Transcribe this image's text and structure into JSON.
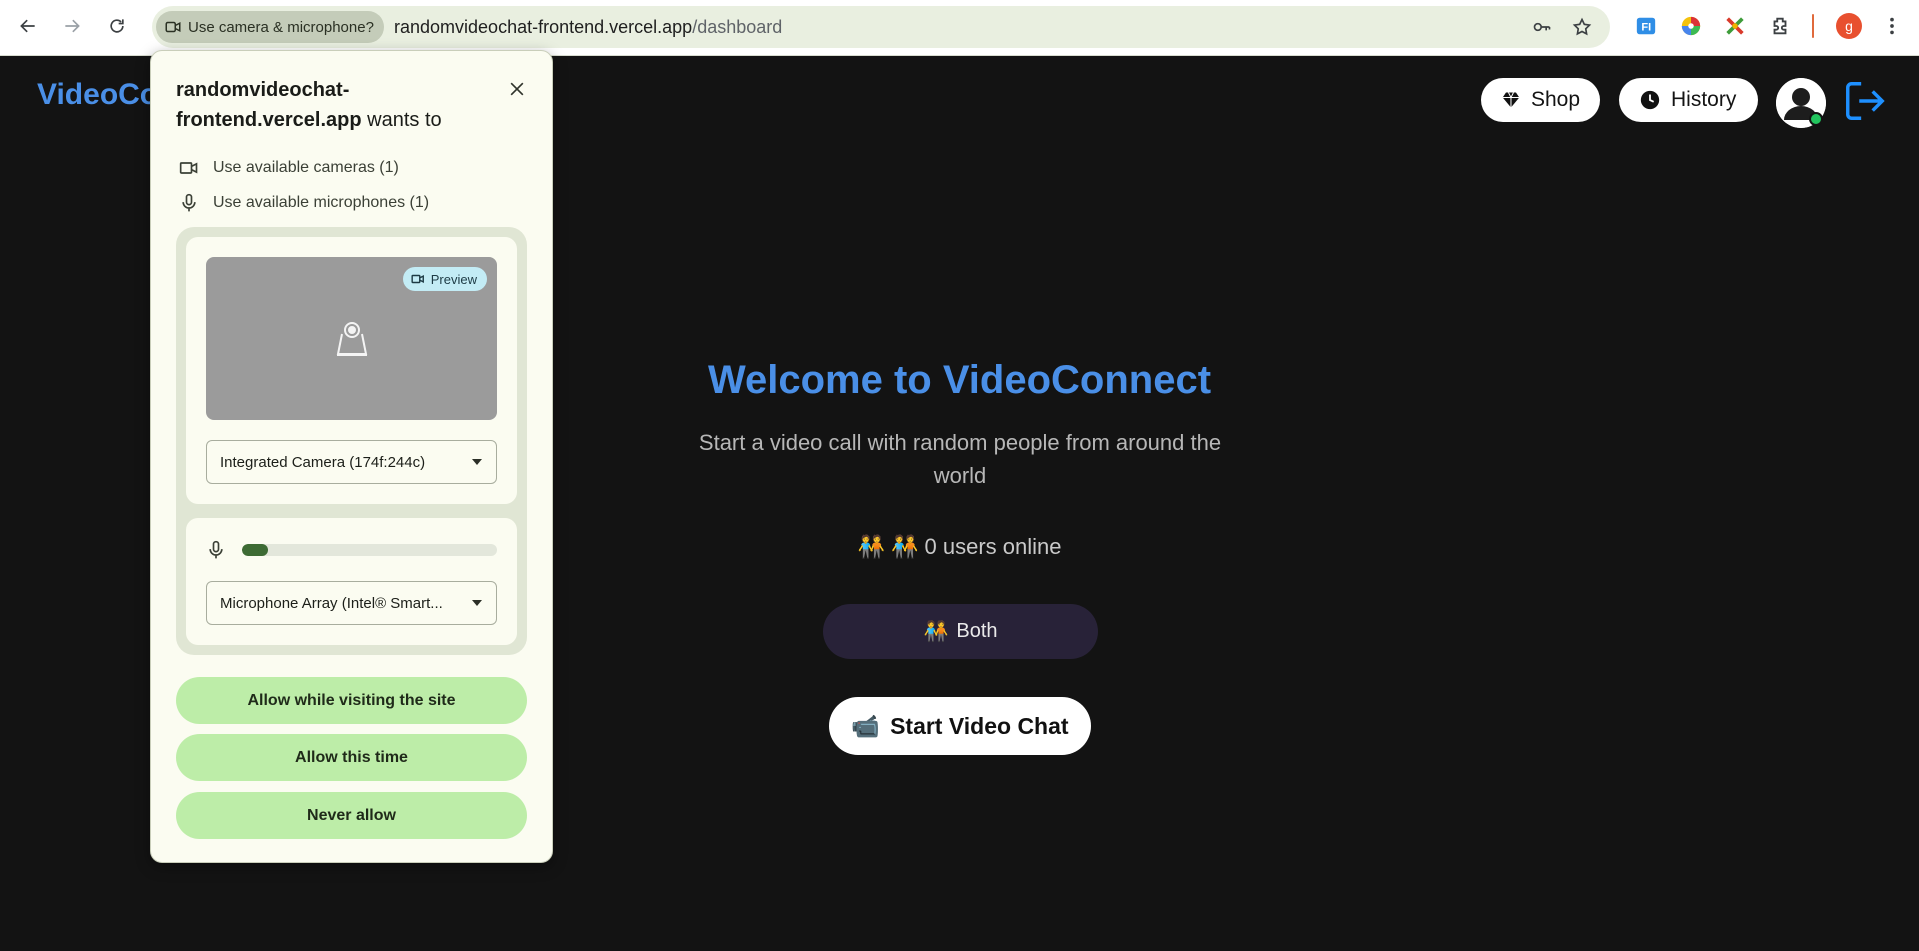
{
  "browser": {
    "permission_chip": "Use camera & microphone?",
    "url_domain": "randomvideochat-frontend.vercel.app",
    "url_path": "/dashboard",
    "profile_initial": "g"
  },
  "app": {
    "logo": "VideoConnect",
    "shop_label": "Shop",
    "history_label": "History",
    "welcome_title": "Welcome to VideoConnect",
    "welcome_subtitle": "Start a video call with random people from around the world",
    "online_icons": "🧑‍🤝‍🧑 🧑‍🤝‍🧑",
    "online_text": "0 users online",
    "gender_icon": "🧑‍🤝‍🧑",
    "gender_label": "Both",
    "start_icon": "📹",
    "start_label": "Start Video Chat",
    "accent_color": "#4a8fe7"
  },
  "permission_popup": {
    "site": "randomvideochat-frontend.vercel.app",
    "wants_to": "wants to",
    "camera_request": "Use available cameras (1)",
    "microphone_request": "Use available microphones (1)",
    "preview_badge": "Preview",
    "camera_select": "Integrated Camera (174f:244c)",
    "microphone_select": "Microphone Array (Intel® Smart...",
    "mic_level": 0.1,
    "allow_visiting": "Allow while visiting the site",
    "allow_once": "Allow this time",
    "never_allow": "Never allow"
  }
}
